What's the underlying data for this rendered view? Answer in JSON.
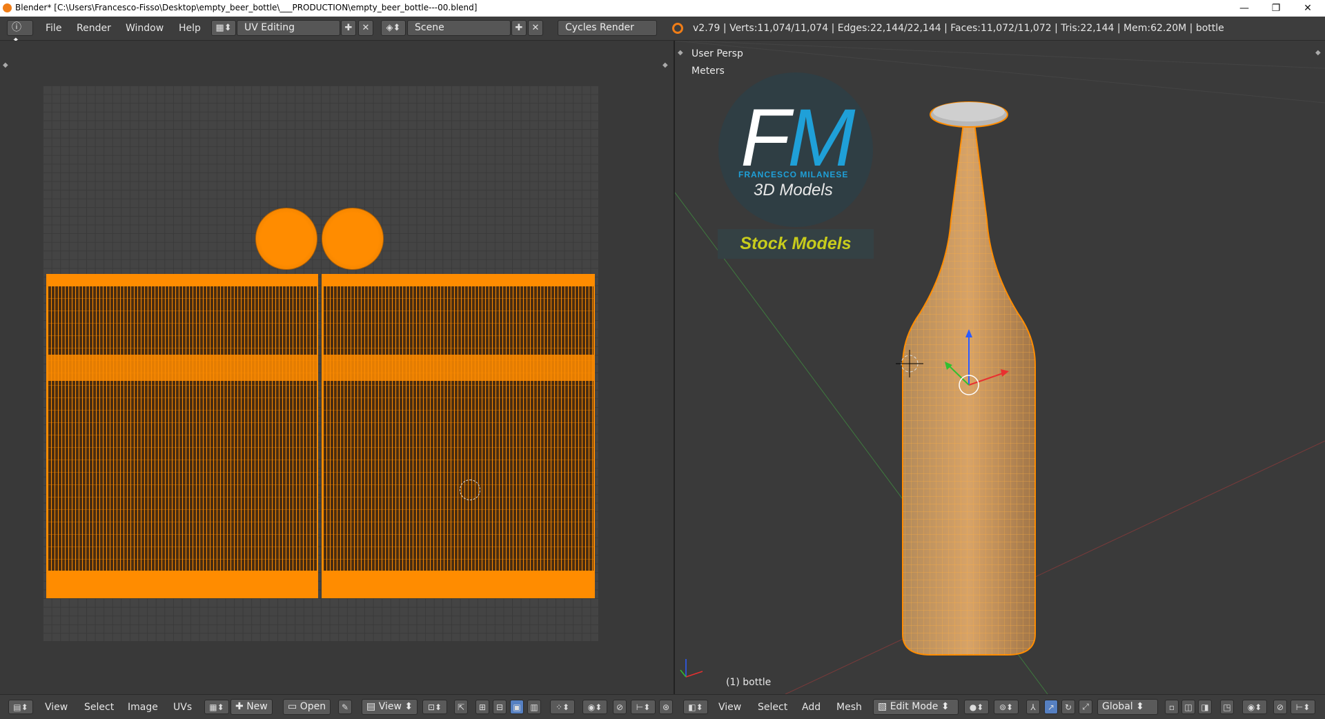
{
  "window": {
    "title": "Blender* [C:\\Users\\Francesco-Fisso\\Desktop\\empty_beer_bottle\\___PRODUCTION\\empty_beer_bottle---00.blend]",
    "minimize": "—",
    "maximize": "❐",
    "close": "✕"
  },
  "info_header": {
    "menus": [
      "File",
      "Render",
      "Window",
      "Help"
    ],
    "layout": "UV Editing",
    "scene": "Scene",
    "engine": "Cycles Render",
    "stats": "v2.79 | Verts:11,074/11,074 | Edges:22,144/22,144 | Faces:11,072/11,072 | Tris:22,144 | Mem:62.20M | bottle"
  },
  "uv_editor": {
    "menus": [
      "View",
      "Select",
      "Image",
      "UVs"
    ],
    "new_label": "New",
    "open_label": "Open",
    "view_label": "View"
  },
  "viewport": {
    "perspective": "User Persp",
    "units": "Meters",
    "object_label": "(1) bottle",
    "menus": [
      "View",
      "Select",
      "Add",
      "Mesh"
    ],
    "mode": "Edit Mode",
    "orientation": "Global"
  },
  "logo": {
    "initial_f": "F",
    "initial_m": "M",
    "name": "FRANCESCO MILANESE",
    "subtitle": "3D Models",
    "banner": "Stock Models"
  },
  "colors": {
    "selection_orange": "#ff8c00",
    "logo_blue": "#1fa0d8",
    "banner_text": "#c8cc1c"
  }
}
